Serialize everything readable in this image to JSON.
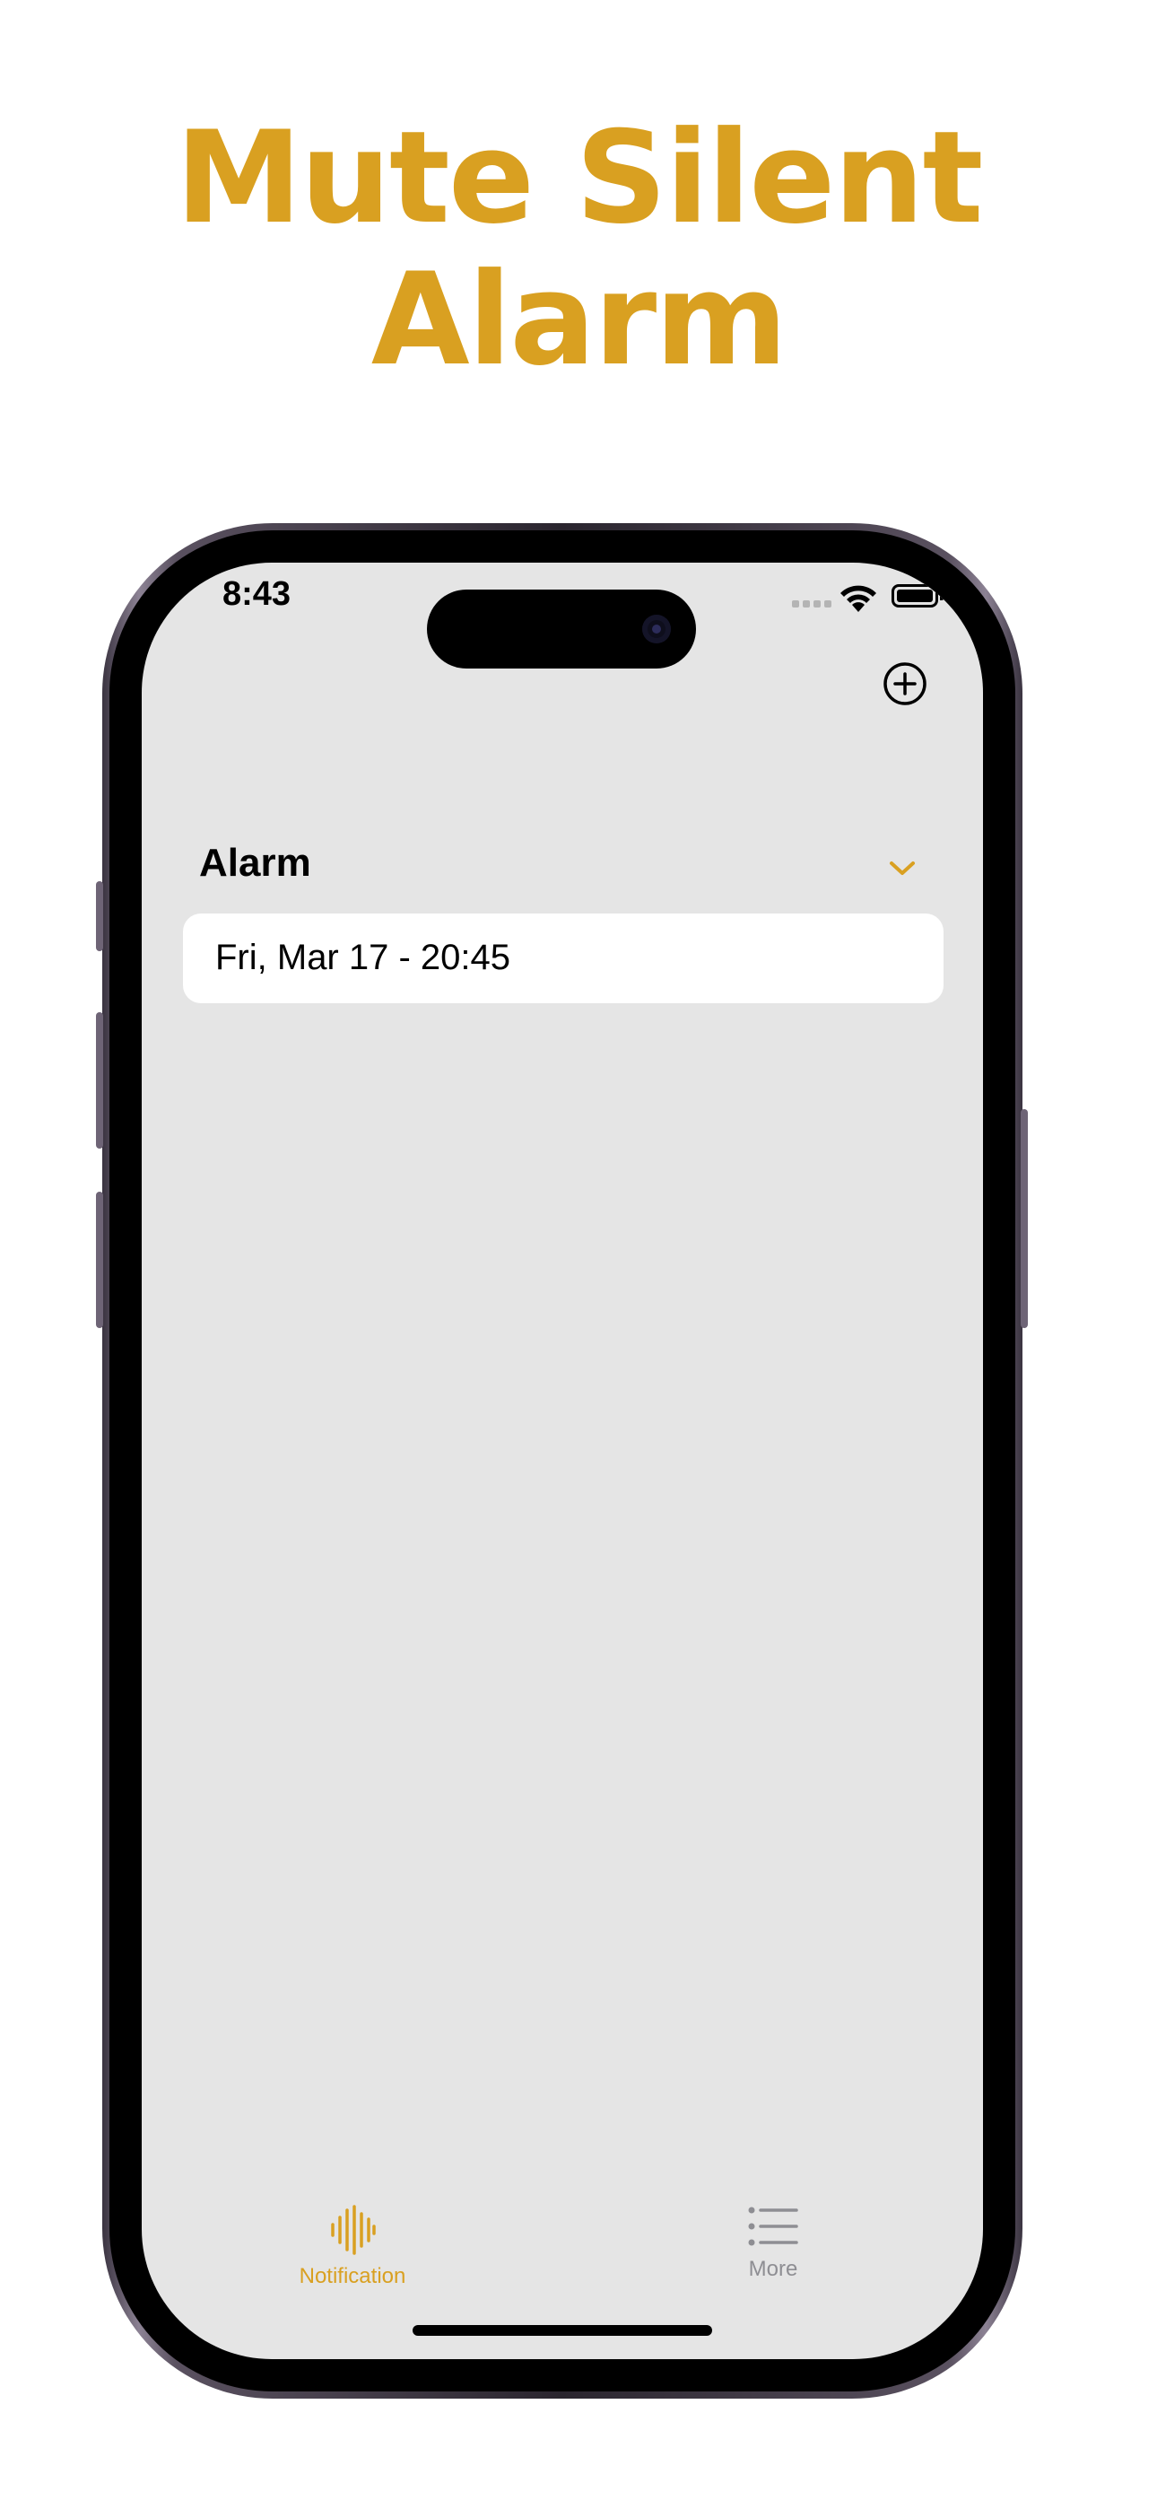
{
  "headline": {
    "line1": "Mute Silent",
    "line2": "Alarm",
    "color": "#d9a021"
  },
  "status_bar": {
    "time": "8:43"
  },
  "toolbar": {
    "add_icon": "plus-circle-icon"
  },
  "section": {
    "title": "Alarm",
    "chevron_icon": "chevron-down-icon",
    "accent": "#d9a021"
  },
  "alarms": [
    {
      "label": "Fri, Mar 17 - 20:45"
    }
  ],
  "tab_bar": {
    "tabs": [
      {
        "label": "Notification",
        "icon": "waveform-icon",
        "selected": true,
        "color": "#d9a021"
      },
      {
        "label": "More",
        "icon": "list-icon",
        "selected": false,
        "color": "#8e8e93"
      }
    ]
  }
}
